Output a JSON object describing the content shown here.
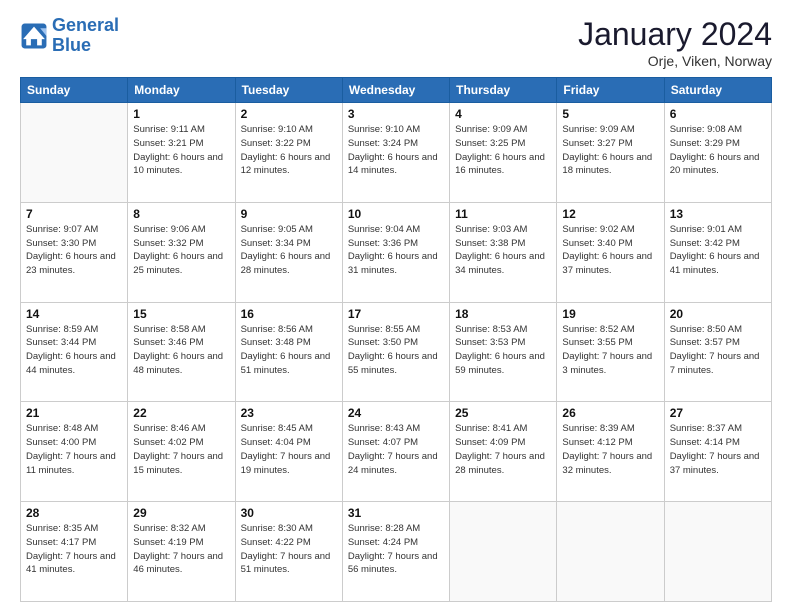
{
  "logo": {
    "line1": "General",
    "line2": "Blue"
  },
  "header": {
    "month": "January 2024",
    "location": "Orje, Viken, Norway"
  },
  "weekdays": [
    "Sunday",
    "Monday",
    "Tuesday",
    "Wednesday",
    "Thursday",
    "Friday",
    "Saturday"
  ],
  "weeks": [
    [
      {
        "day": null
      },
      {
        "day": 1,
        "sunrise": "9:11 AM",
        "sunset": "3:21 PM",
        "daylight": "6 hours and 10 minutes."
      },
      {
        "day": 2,
        "sunrise": "9:10 AM",
        "sunset": "3:22 PM",
        "daylight": "6 hours and 12 minutes."
      },
      {
        "day": 3,
        "sunrise": "9:10 AM",
        "sunset": "3:24 PM",
        "daylight": "6 hours and 14 minutes."
      },
      {
        "day": 4,
        "sunrise": "9:09 AM",
        "sunset": "3:25 PM",
        "daylight": "6 hours and 16 minutes."
      },
      {
        "day": 5,
        "sunrise": "9:09 AM",
        "sunset": "3:27 PM",
        "daylight": "6 hours and 18 minutes."
      },
      {
        "day": 6,
        "sunrise": "9:08 AM",
        "sunset": "3:29 PM",
        "daylight": "6 hours and 20 minutes."
      }
    ],
    [
      {
        "day": 7,
        "sunrise": "9:07 AM",
        "sunset": "3:30 PM",
        "daylight": "6 hours and 23 minutes."
      },
      {
        "day": 8,
        "sunrise": "9:06 AM",
        "sunset": "3:32 PM",
        "daylight": "6 hours and 25 minutes."
      },
      {
        "day": 9,
        "sunrise": "9:05 AM",
        "sunset": "3:34 PM",
        "daylight": "6 hours and 28 minutes."
      },
      {
        "day": 10,
        "sunrise": "9:04 AM",
        "sunset": "3:36 PM",
        "daylight": "6 hours and 31 minutes."
      },
      {
        "day": 11,
        "sunrise": "9:03 AM",
        "sunset": "3:38 PM",
        "daylight": "6 hours and 34 minutes."
      },
      {
        "day": 12,
        "sunrise": "9:02 AM",
        "sunset": "3:40 PM",
        "daylight": "6 hours and 37 minutes."
      },
      {
        "day": 13,
        "sunrise": "9:01 AM",
        "sunset": "3:42 PM",
        "daylight": "6 hours and 41 minutes."
      }
    ],
    [
      {
        "day": 14,
        "sunrise": "8:59 AM",
        "sunset": "3:44 PM",
        "daylight": "6 hours and 44 minutes."
      },
      {
        "day": 15,
        "sunrise": "8:58 AM",
        "sunset": "3:46 PM",
        "daylight": "6 hours and 48 minutes."
      },
      {
        "day": 16,
        "sunrise": "8:56 AM",
        "sunset": "3:48 PM",
        "daylight": "6 hours and 51 minutes."
      },
      {
        "day": 17,
        "sunrise": "8:55 AM",
        "sunset": "3:50 PM",
        "daylight": "6 hours and 55 minutes."
      },
      {
        "day": 18,
        "sunrise": "8:53 AM",
        "sunset": "3:53 PM",
        "daylight": "6 hours and 59 minutes."
      },
      {
        "day": 19,
        "sunrise": "8:52 AM",
        "sunset": "3:55 PM",
        "daylight": "7 hours and 3 minutes."
      },
      {
        "day": 20,
        "sunrise": "8:50 AM",
        "sunset": "3:57 PM",
        "daylight": "7 hours and 7 minutes."
      }
    ],
    [
      {
        "day": 21,
        "sunrise": "8:48 AM",
        "sunset": "4:00 PM",
        "daylight": "7 hours and 11 minutes."
      },
      {
        "day": 22,
        "sunrise": "8:46 AM",
        "sunset": "4:02 PM",
        "daylight": "7 hours and 15 minutes."
      },
      {
        "day": 23,
        "sunrise": "8:45 AM",
        "sunset": "4:04 PM",
        "daylight": "7 hours and 19 minutes."
      },
      {
        "day": 24,
        "sunrise": "8:43 AM",
        "sunset": "4:07 PM",
        "daylight": "7 hours and 24 minutes."
      },
      {
        "day": 25,
        "sunrise": "8:41 AM",
        "sunset": "4:09 PM",
        "daylight": "7 hours and 28 minutes."
      },
      {
        "day": 26,
        "sunrise": "8:39 AM",
        "sunset": "4:12 PM",
        "daylight": "7 hours and 32 minutes."
      },
      {
        "day": 27,
        "sunrise": "8:37 AM",
        "sunset": "4:14 PM",
        "daylight": "7 hours and 37 minutes."
      }
    ],
    [
      {
        "day": 28,
        "sunrise": "8:35 AM",
        "sunset": "4:17 PM",
        "daylight": "7 hours and 41 minutes."
      },
      {
        "day": 29,
        "sunrise": "8:32 AM",
        "sunset": "4:19 PM",
        "daylight": "7 hours and 46 minutes."
      },
      {
        "day": 30,
        "sunrise": "8:30 AM",
        "sunset": "4:22 PM",
        "daylight": "7 hours and 51 minutes."
      },
      {
        "day": 31,
        "sunrise": "8:28 AM",
        "sunset": "4:24 PM",
        "daylight": "7 hours and 56 minutes."
      },
      {
        "day": null
      },
      {
        "day": null
      },
      {
        "day": null
      }
    ]
  ],
  "labels": {
    "sunrise": "Sunrise:",
    "sunset": "Sunset:",
    "daylight": "Daylight:"
  }
}
